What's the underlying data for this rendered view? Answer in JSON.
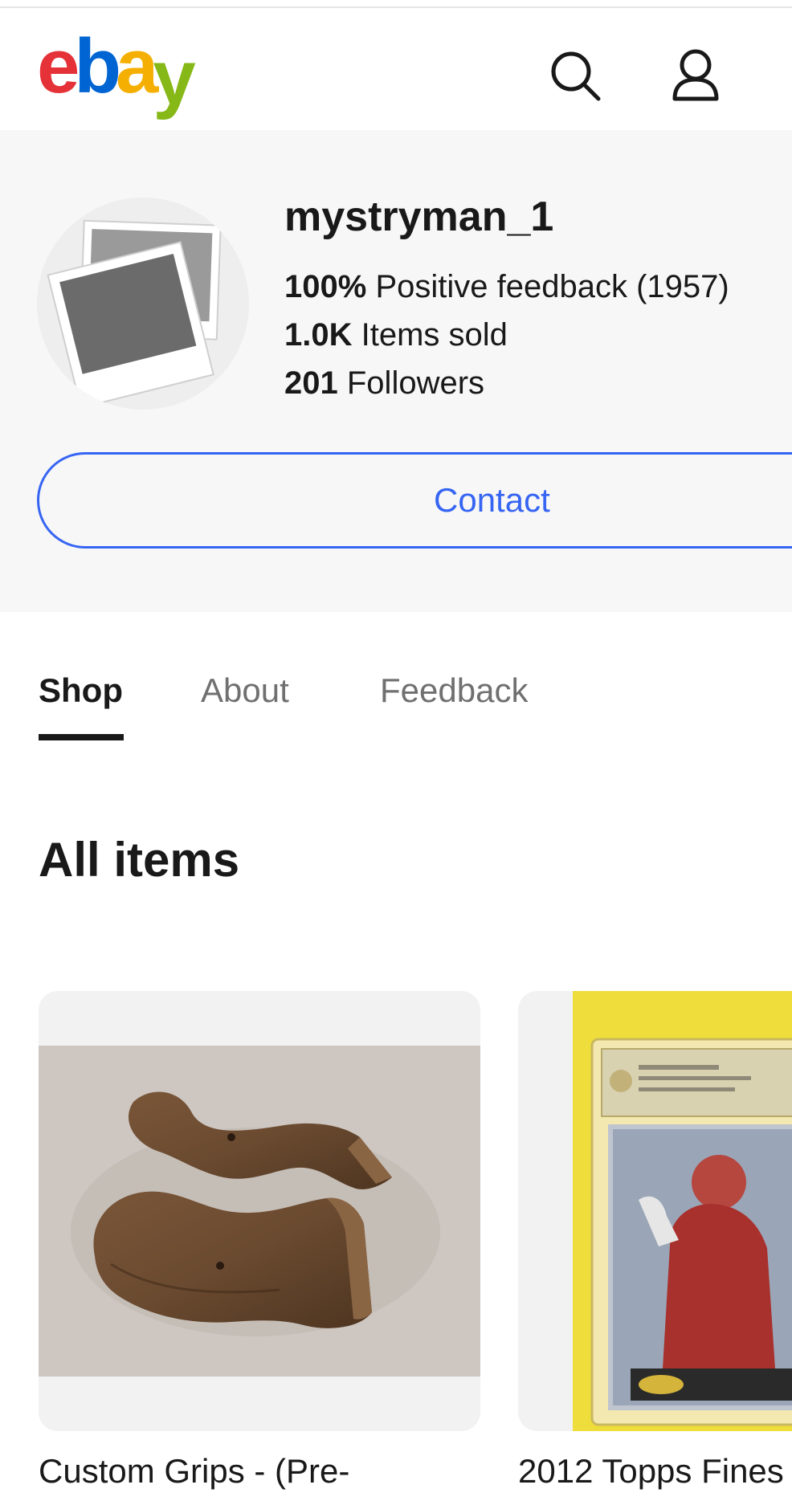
{
  "header": {
    "logo": {
      "letters": [
        "e",
        "b",
        "a",
        "y"
      ],
      "alt": "ebay"
    },
    "icons": {
      "search": "search-icon",
      "account": "user-icon"
    }
  },
  "seller": {
    "name": "mystryman_1",
    "feedback_value": "100%",
    "feedback_label": "Positive feedback (1957)",
    "sold_value": "1.0K",
    "sold_label": "Items sold",
    "followers_value": "201",
    "followers_label": "Followers",
    "avatar_icon": "photo-placeholder-icon"
  },
  "contact": {
    "label": "Contact"
  },
  "tabs": [
    {
      "label": "Shop",
      "active": true
    },
    {
      "label": "About",
      "active": false
    },
    {
      "label": "Feedback",
      "active": false
    }
  ],
  "section": {
    "title": "All items"
  },
  "items": [
    {
      "title": "Custom Grips - (Pre-",
      "image": "wooden-pistol-grips-photo"
    },
    {
      "title": "2012 Topps Fines",
      "image": "graded-baseball-card-photo"
    }
  ],
  "colors": {
    "accent": "#3665f3",
    "text": "#191919",
    "muted": "#707070",
    "panel": "#f7f7f7",
    "logo_e": "#e53238",
    "logo_b": "#0064d2",
    "logo_a": "#f5af02",
    "logo_y": "#86b817"
  }
}
